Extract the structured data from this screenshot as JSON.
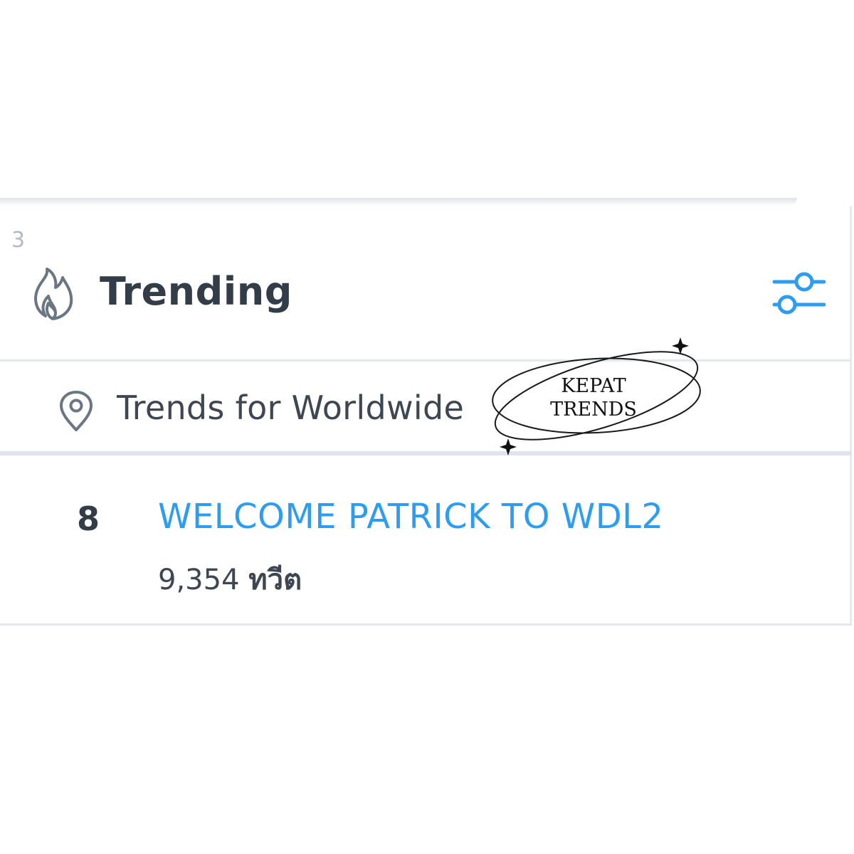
{
  "corner_number": "3",
  "header": {
    "icon": "flame-icon",
    "title": "Trending",
    "settings_icon": "settings-sliders-icon",
    "accent_color": "#2e9cf0"
  },
  "location": {
    "icon": "location-pin-icon",
    "text": "Trends for Worldwide"
  },
  "trends": [
    {
      "rank": "8",
      "name": "WELCOME PATRICK TO WDL2",
      "count": "9,354",
      "unit": "ทวีต"
    }
  ],
  "watermark": {
    "line1": "KEPAT",
    "line2": "TRENDS",
    "icon": "sparkle-star-icon"
  }
}
